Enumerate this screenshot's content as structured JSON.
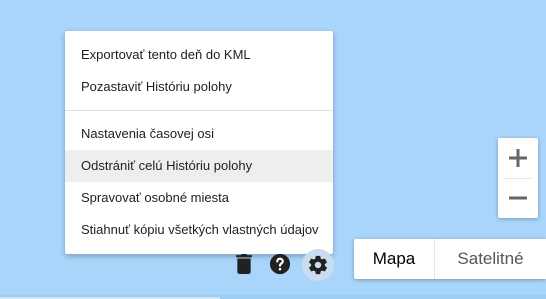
{
  "menu": {
    "items": [
      {
        "label": "Exportovať tento deň do KML"
      },
      {
        "label": "Pozastaviť Históriu polohy"
      },
      {
        "label": "Nastavenia časovej osi"
      },
      {
        "label": "Odstrániť celú Históriu polohy"
      },
      {
        "label": "Spravovať osobné miesta"
      },
      {
        "label": "Stiahnuť kópiu všetkých vlastných údajov"
      }
    ]
  },
  "toolbar": {
    "icons": [
      "trash-icon",
      "help-icon",
      "settings-icon"
    ]
  },
  "zoom": {
    "in_label": "+",
    "out_label": "−"
  },
  "map_type": {
    "map_label": "Mapa",
    "satellite_label": "Satelitné",
    "selected": "Mapa"
  },
  "colors": {
    "map_water": "#a9d5fb",
    "menu_highlight": "#eeeeee",
    "active_icon_bg": "#c9dcf0",
    "icon_color": "#212121"
  }
}
